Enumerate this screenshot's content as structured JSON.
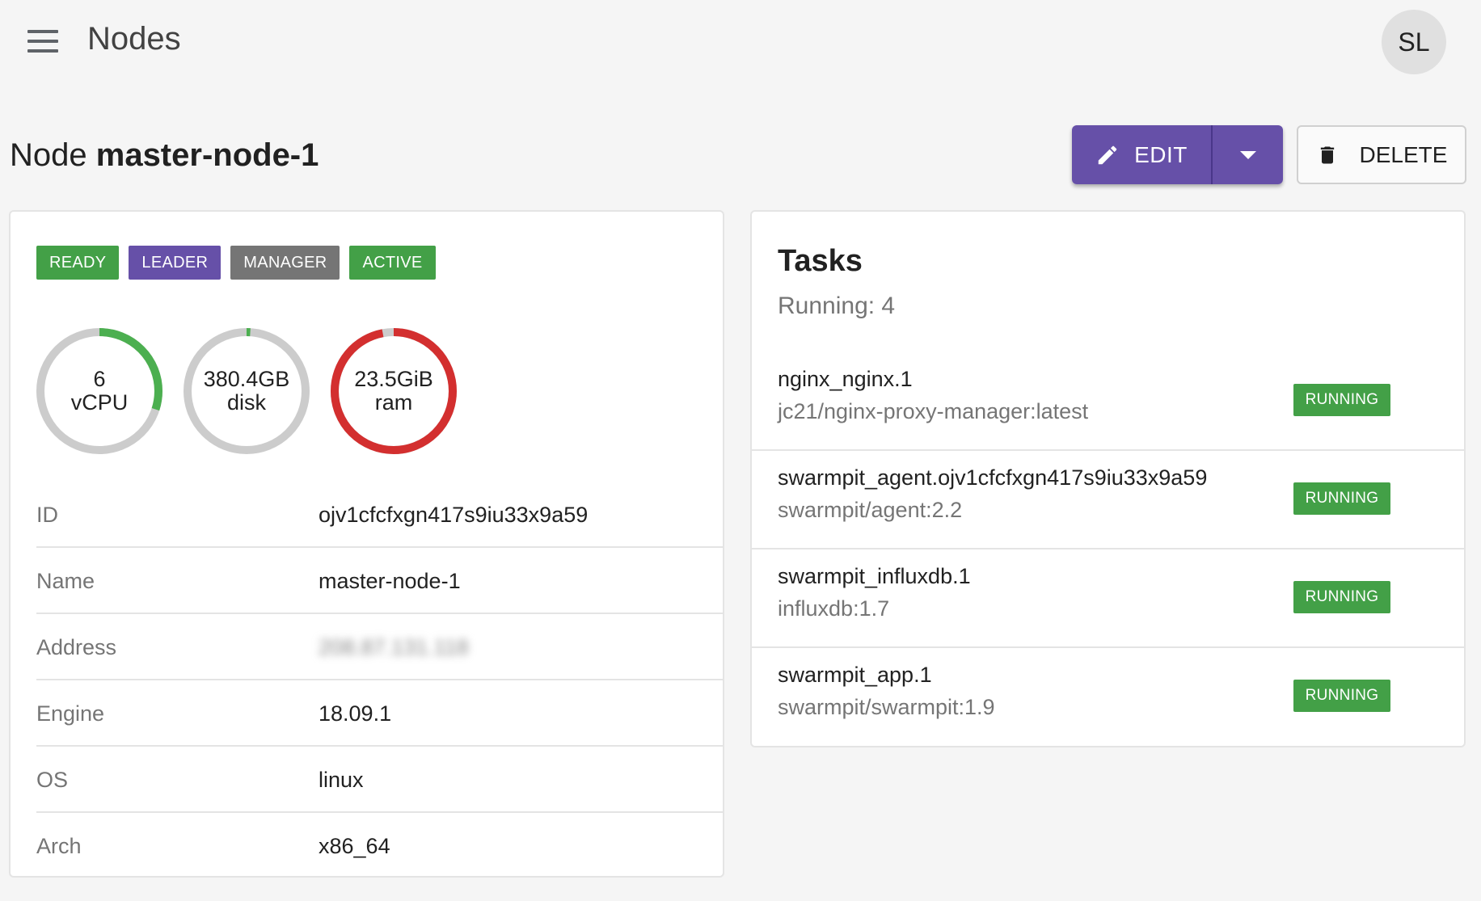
{
  "appbar": {
    "title": "Nodes",
    "avatar_initials": "SL"
  },
  "page": {
    "title_prefix": "Node",
    "node_name": "master-node-1"
  },
  "actions": {
    "edit_label": "EDIT",
    "delete_label": "DELETE"
  },
  "badges": [
    {
      "label": "READY",
      "color": "#43a047"
    },
    {
      "label": "LEADER",
      "color": "#6650a8"
    },
    {
      "label": "MANAGER",
      "color": "#757575"
    },
    {
      "label": "ACTIVE",
      "color": "#43a047"
    }
  ],
  "gauges": [
    {
      "value": "6",
      "unit": "vCPU",
      "usage_fraction": 0.3,
      "color": "#4caf50"
    },
    {
      "value": "380.4GB",
      "unit": "disk",
      "usage_fraction": 0.01,
      "color": "#4caf50"
    },
    {
      "value": "23.5GiB",
      "unit": "ram",
      "usage_fraction": 0.97,
      "color": "#d32f2f"
    }
  ],
  "info": {
    "id": {
      "key": "ID",
      "value": "ojv1cfcfxgn417s9iu33x9a59"
    },
    "name": {
      "key": "Name",
      "value": "master-node-1"
    },
    "address": {
      "key": "Address",
      "value": "208.87.131.118"
    },
    "engine": {
      "key": "Engine",
      "value": "18.09.1"
    },
    "os": {
      "key": "OS",
      "value": "linux"
    },
    "arch": {
      "key": "Arch",
      "value": "x86_64"
    }
  },
  "tasks": {
    "title": "Tasks",
    "summary": "Running: 4",
    "items": [
      {
        "name": "nginx_nginx.1",
        "image": "jc21/nginx-proxy-manager:latest",
        "status": "RUNNING"
      },
      {
        "name": "swarmpit_agent.ojv1cfcfxgn417s9iu33x9a59",
        "image": "swarmpit/agent:2.2",
        "status": "RUNNING"
      },
      {
        "name": "swarmpit_influxdb.1",
        "image": "influxdb:1.7",
        "status": "RUNNING"
      },
      {
        "name": "swarmpit_app.1",
        "image": "swarmpit/swarmpit:1.9",
        "status": "RUNNING"
      }
    ]
  }
}
